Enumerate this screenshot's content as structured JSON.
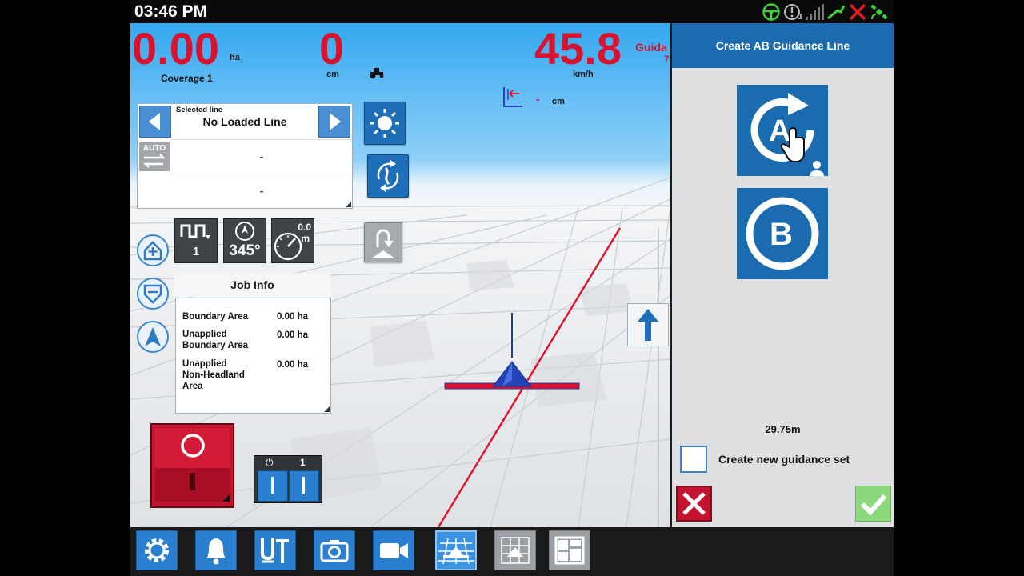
{
  "status_bar": {
    "time": "03:46 PM",
    "icons": [
      "steering-wheel-icon",
      "alert-icon",
      "signal-bars-icon",
      "gps-antenna-icon",
      "no-connection-icon",
      "satellite-icon"
    ]
  },
  "readouts": {
    "coverage_value": "0.00",
    "coverage_unit": "ha",
    "coverage_label": "Coverage 1",
    "offset_value": "0",
    "offset_unit": "cm",
    "speed_value": "45.8",
    "speed_unit": "km/h",
    "guidance_partial": "Guida",
    "guidance_partial_2": "7",
    "xtrack_value": "-",
    "xtrack_unit": "cm"
  },
  "line_panel": {
    "selected_caption": "Selected line",
    "selected_value": "No Loaded Line",
    "auto_label": "AUTO",
    "row1_value": "-",
    "row2_value": "-"
  },
  "tiles": {
    "section_count": "1",
    "heading": "345°",
    "dial_value": "0.0",
    "dial_unit": "m",
    "power_count": "1"
  },
  "job_info": {
    "title": "Job Info",
    "rows": [
      {
        "label_lines": [
          "Boundary Area"
        ],
        "value": "0.00",
        "unit": "ha"
      },
      {
        "label_lines": [
          "Unapplied",
          "Boundary Area"
        ],
        "value": "0.00",
        "unit": "ha"
      },
      {
        "label_lines": [
          "Unapplied",
          "Non-Headland",
          "Area"
        ],
        "value": "0.00",
        "unit": "ha"
      }
    ]
  },
  "side_panel": {
    "title": "Create AB Guidance Line",
    "a_label": "A",
    "b_label": "B",
    "distance": "29.75m",
    "checkbox_label": "Create new guidance set",
    "checkbox_checked": false
  },
  "toolbar": {
    "buttons": [
      "settings",
      "alarms",
      "universal-terminal",
      "screenshot",
      "camera",
      "guidance-view",
      "map-view",
      "layout"
    ]
  },
  "colors": {
    "accent_blue": "#1b6bb0",
    "readout_red": "#d6142f",
    "guidance_line_red": "#e0102a",
    "ok_green": "#8dd77d"
  }
}
